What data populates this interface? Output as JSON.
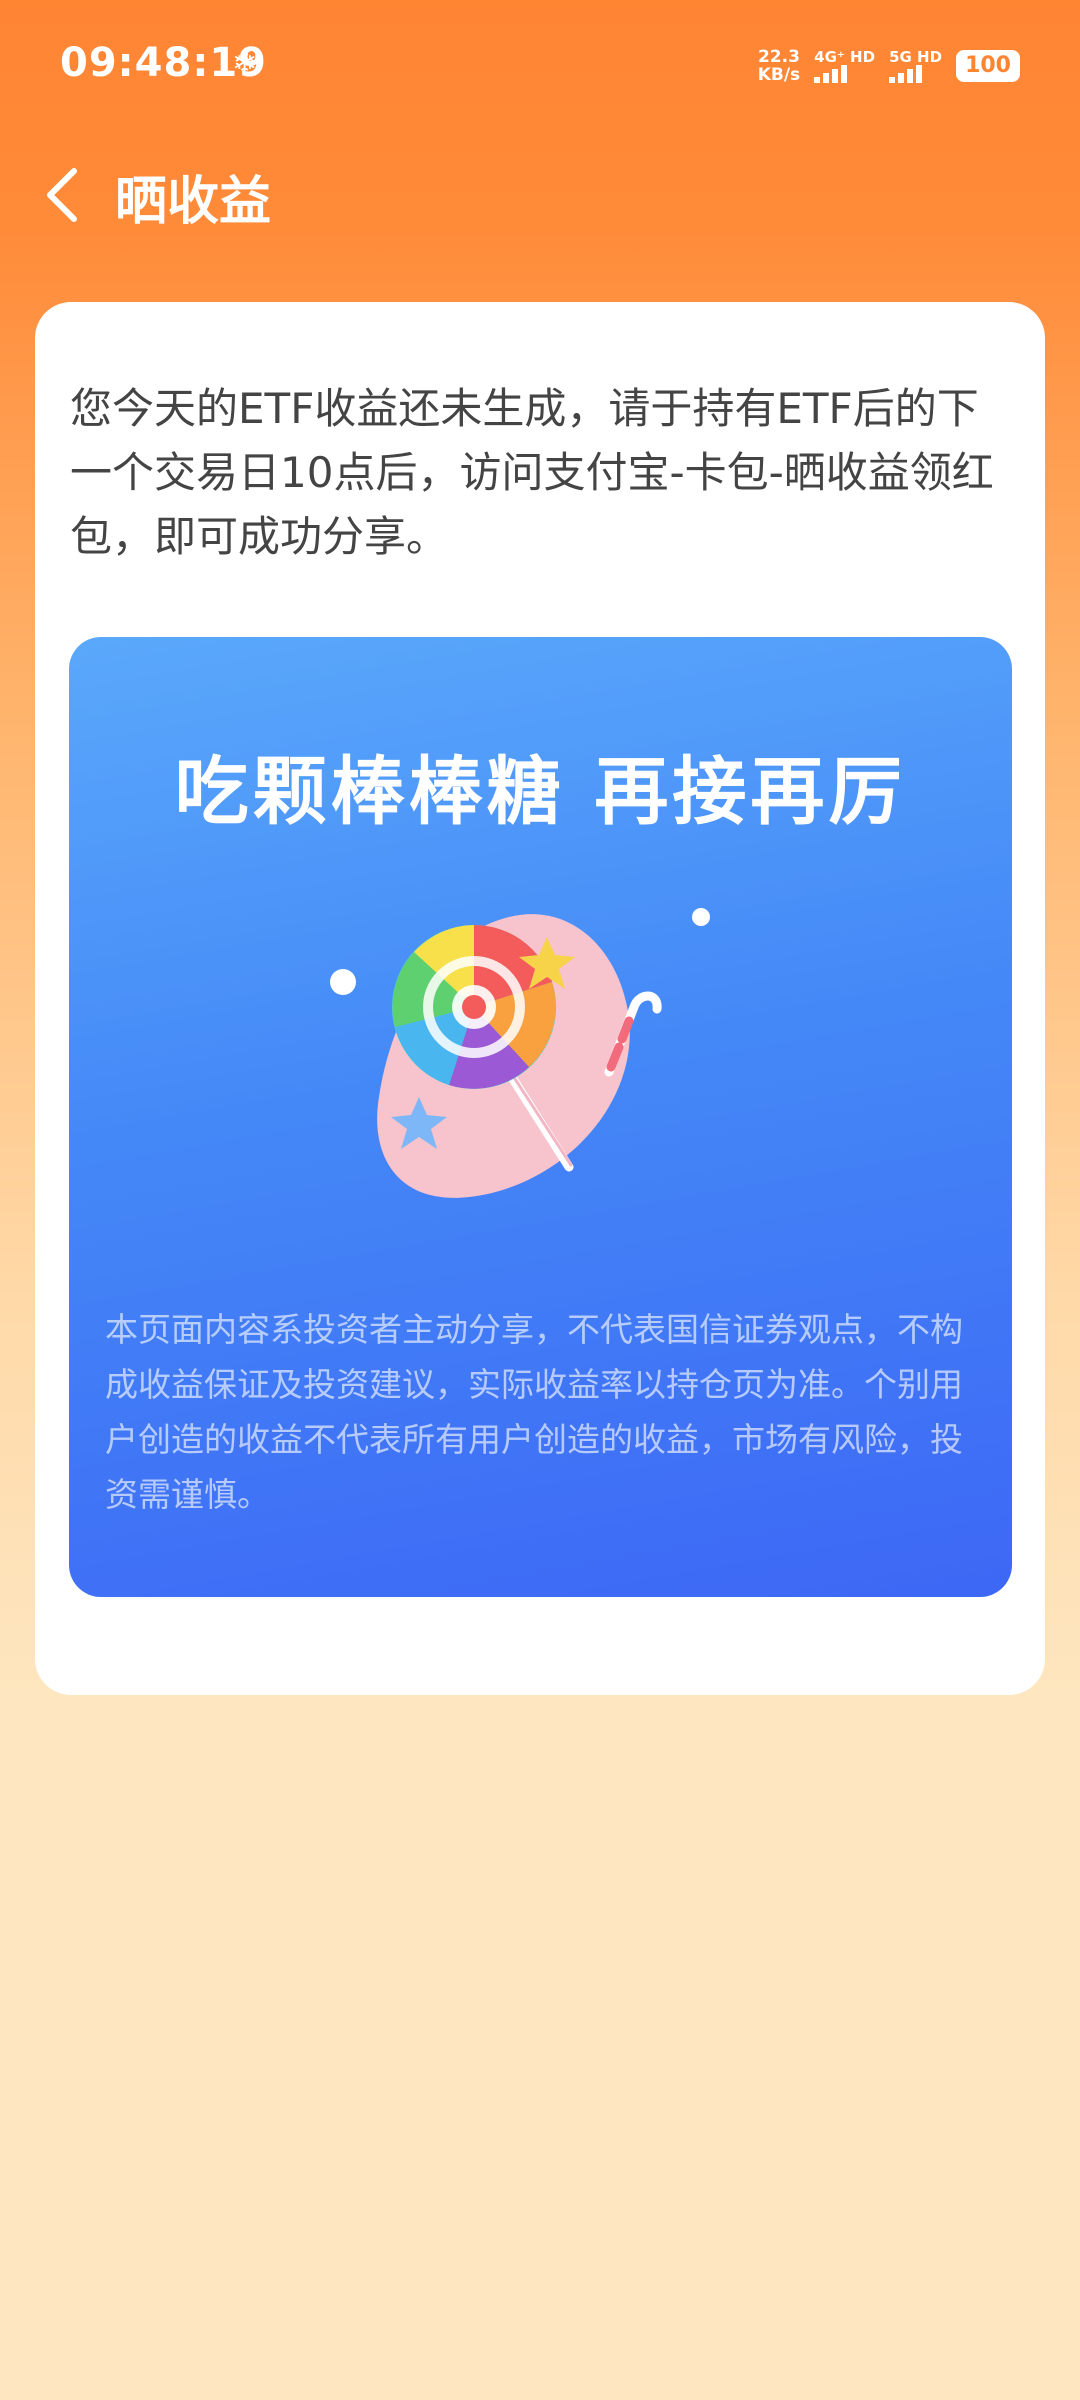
{
  "status_bar": {
    "time": "09:48:19",
    "net_speed_value": "22.3",
    "net_speed_unit": "KB/s",
    "sim1_label": "4G⁺ HD",
    "sim2_label": "5G HD",
    "battery": "100"
  },
  "header": {
    "title": "晒收益"
  },
  "notice": {
    "text": "您今天的ETF收益还未生成，请于持有ETF后的下一个交易日10点后，访问支付宝-卡包-晒收益领红包，即可成功分享。"
  },
  "poster": {
    "title": "吃颗棒棒糖 再接再厉",
    "disclaimer": "本页面内容系投资者主动分享，不代表国信证券观点，不构成收益保证及投资建议，实际收益率以持仓页为准。个别用户创造的收益不代表所有用户创造的收益，市场有风险，投资需谨慎。"
  },
  "colors": {
    "header_bg": "#ff8533",
    "page_bottom_bg": "#fee6c0",
    "poster_gradient_start": "#5aa8fb",
    "poster_gradient_end": "#3d67f5"
  },
  "icons": {
    "back": "back-arrow-icon",
    "status": "snowflake-icon"
  }
}
